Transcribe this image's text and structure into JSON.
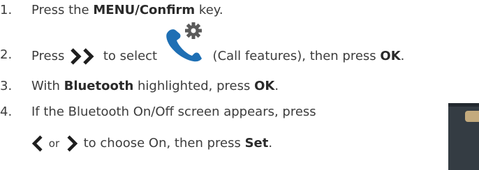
{
  "steps": [
    {
      "number": "1.",
      "parts": [
        "Press the ",
        "MENU/Confirm",
        " key."
      ]
    },
    {
      "number": "2.",
      "parts": [
        "Press ",
        " to select ",
        " (Call features), then press ",
        "OK",
        "."
      ],
      "icons": [
        "double-right-chevron-icon",
        "phone-settings-icon"
      ]
    },
    {
      "number": "3.",
      "parts": [
        "With ",
        "Bluetooth",
        " highlighted, press ",
        "OK",
        "."
      ]
    },
    {
      "number": "4.",
      "parts": [
        "If the Bluetooth On/Off screen appears, press"
      ]
    },
    {
      "number": "",
      "parts": [
        " or ",
        " to choose On, then press ",
        "Set",
        "."
      ],
      "icons": [
        "left-chevron-icon",
        "right-chevron-icon"
      ]
    }
  ],
  "colors": {
    "text": "#3c3c3c",
    "icon_dark": "#1e1e1e",
    "phone_blue": "#1e6fb4",
    "screen_bg": "#343c43",
    "screen_highlight": "#c3aa7d"
  }
}
